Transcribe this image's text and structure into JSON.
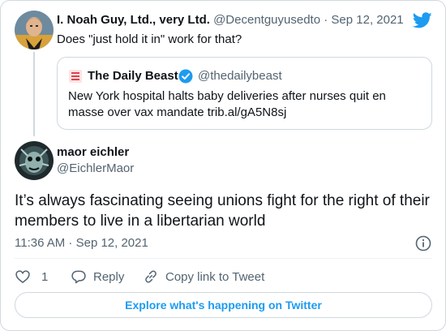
{
  "colors": {
    "brand_blue": "#1d9bf0",
    "muted": "#536471",
    "border": "#cfd9de",
    "text": "#0f1419"
  },
  "parent_tweet": {
    "name": "I. Noah Guy, Ltd., very Ltd.",
    "handle": "@Decentguyusedto",
    "separator": "·",
    "date": "Sep 12, 2021",
    "text": "Does \"just hold it in\" work for that?",
    "avatar_icon": "star-trek-captain-avatar"
  },
  "quoted_tweet": {
    "name": "The Daily Beast",
    "handle": "@thedailybeast",
    "text": "New York hospital halts baby deliveries after nurses quit en masse over vax mandate trib.al/gA5N8sj",
    "logo_icon": "daily-beast-logo-icon",
    "verified_icon": "verified-badge-icon"
  },
  "main_tweet": {
    "name": "maor eichler",
    "handle": "@EichlerMaor",
    "text": "It’s always fascinating seeing unions fight for the right of their members to live in a libertarian world",
    "timestamp": "11:36 AM · Sep 12, 2021",
    "avatar_icon": "creature-avatar"
  },
  "actions": {
    "like_count": "1",
    "reply_label": "Reply",
    "copy_label": "Copy link to Tweet"
  },
  "explore_label": "Explore what's happening on Twitter",
  "icons": [
    "twitter-bird-icon",
    "info-icon",
    "heart-icon",
    "reply-icon",
    "link-icon"
  ]
}
